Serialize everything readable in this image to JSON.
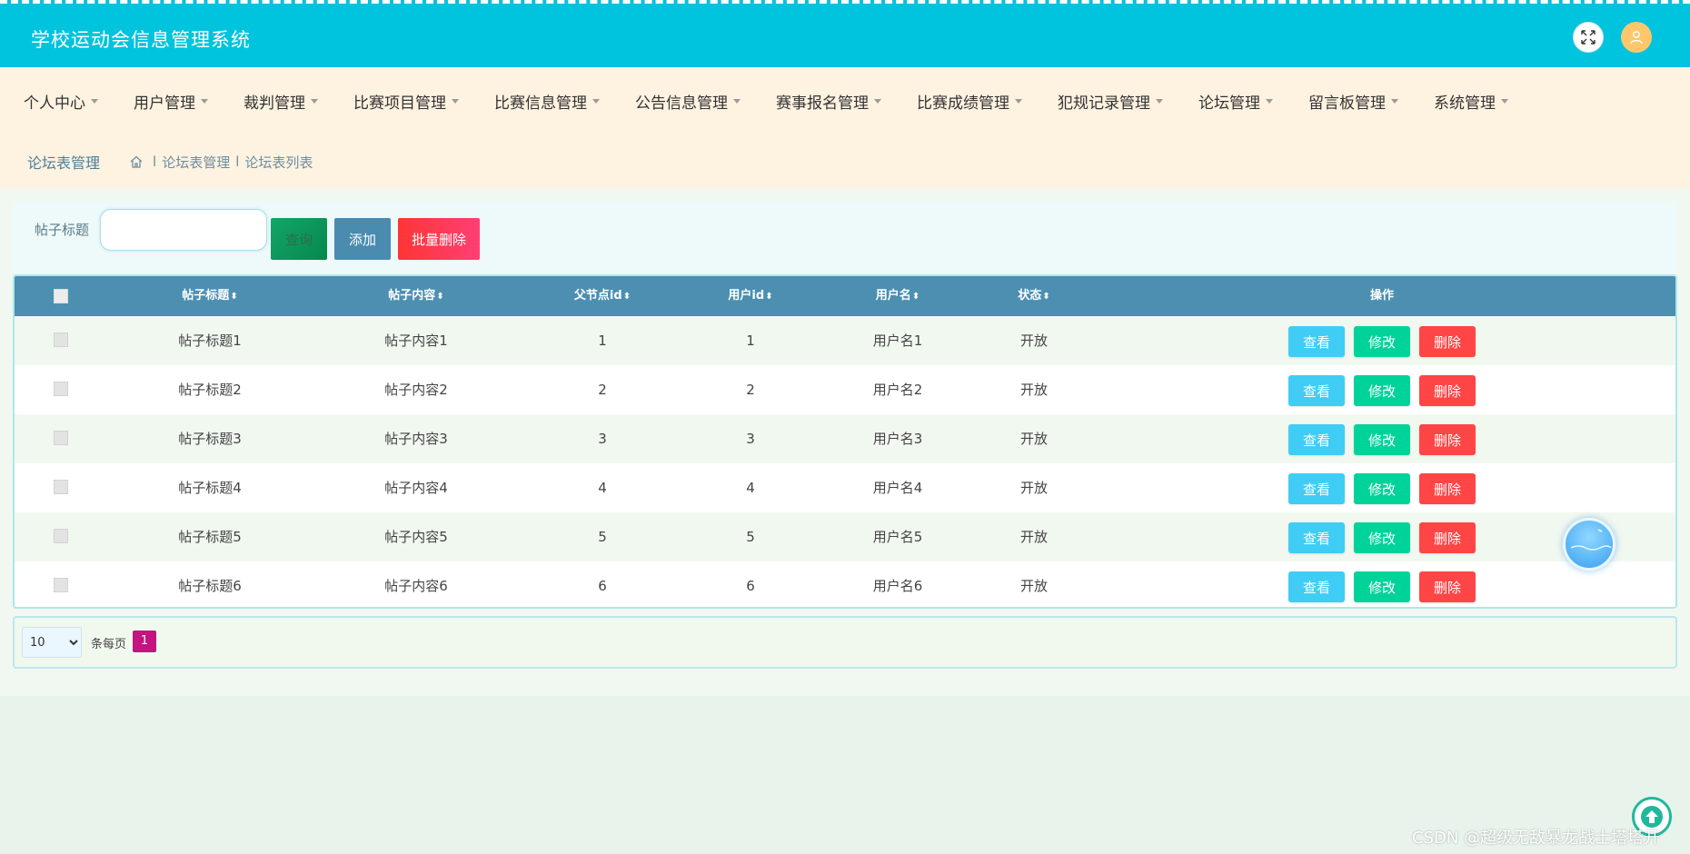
{
  "header": {
    "title": "学校运动会信息管理系统",
    "expand_icon": "expand-icon",
    "user_icon": "user-icon",
    "accent_color": "#00c3dd"
  },
  "nav": {
    "items": [
      {
        "label": "个人中心"
      },
      {
        "label": "用户管理"
      },
      {
        "label": "裁判管理"
      },
      {
        "label": "比赛项目管理"
      },
      {
        "label": "比赛信息管理"
      },
      {
        "label": "公告信息管理"
      },
      {
        "label": "赛事报名管理"
      },
      {
        "label": "比赛成绩管理"
      },
      {
        "label": "犯规记录管理"
      },
      {
        "label": "论坛管理"
      },
      {
        "label": "留言板管理"
      },
      {
        "label": "系统管理"
      }
    ]
  },
  "breadcrumb": {
    "page_title": "论坛表管理",
    "home_icon": "home-icon",
    "items": [
      "论坛表管理",
      "论坛表列表"
    ],
    "separator": "l"
  },
  "search": {
    "label": "帖子标题",
    "value": "",
    "placeholder": "",
    "query_label": "查询",
    "add_label": "添加",
    "batch_delete_label": "批量删除"
  },
  "table": {
    "columns": [
      "帖子标题",
      "帖子内容",
      "父节点id",
      "用户id",
      "用户名",
      "状态",
      "操作"
    ],
    "sort_icon": "⬍",
    "rows": [
      {
        "title": "帖子标题1",
        "content": "帖子内容1",
        "parent_id": "1",
        "user_id": "1",
        "username": "用户名1",
        "status": "开放"
      },
      {
        "title": "帖子标题2",
        "content": "帖子内容2",
        "parent_id": "2",
        "user_id": "2",
        "username": "用户名2",
        "status": "开放"
      },
      {
        "title": "帖子标题3",
        "content": "帖子内容3",
        "parent_id": "3",
        "user_id": "3",
        "username": "用户名3",
        "status": "开放"
      },
      {
        "title": "帖子标题4",
        "content": "帖子内容4",
        "parent_id": "4",
        "user_id": "4",
        "username": "用户名4",
        "status": "开放"
      },
      {
        "title": "帖子标题5",
        "content": "帖子内容5",
        "parent_id": "5",
        "user_id": "5",
        "username": "用户名5",
        "status": "开放"
      },
      {
        "title": "帖子标题6",
        "content": "帖子内容6",
        "parent_id": "6",
        "user_id": "6",
        "username": "用户名6",
        "status": "开放"
      }
    ],
    "actions": {
      "view": "查看",
      "edit": "修改",
      "delete": "删除"
    }
  },
  "pagination": {
    "page_size": "10",
    "page_size_options": [
      "10"
    ],
    "per_page_label": "条每页",
    "current_page": "1"
  },
  "watermark": "CSDN @超级无敌暴龙战士塔塔开"
}
